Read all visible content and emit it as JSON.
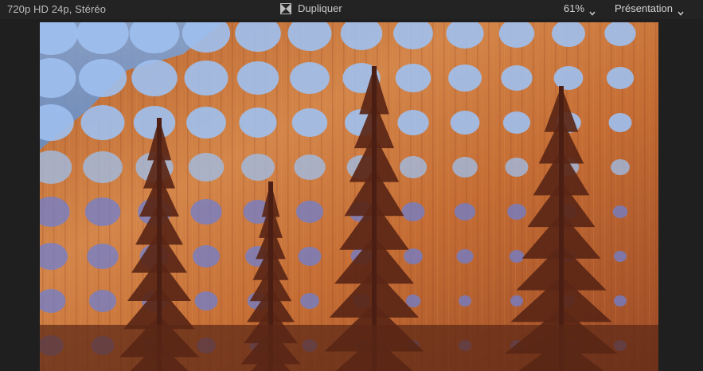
{
  "toolbar": {
    "format_label": "720p HD 24p, Stéréo",
    "clip_icon": "clip-icon",
    "clip_title": "Dupliquer",
    "zoom_label": "61%",
    "zoom_icon": "chevron-down-icon",
    "view_label": "Présentation",
    "view_icon": "chevron-down-icon"
  },
  "viewer": {
    "content": "video-frame-halftone-trees",
    "colors": {
      "background": "#1f1f1f",
      "sky": "#6e9bd6",
      "cliff": "#c9753c",
      "trees": "#5a2616",
      "dots": "#8fb4ea"
    }
  }
}
